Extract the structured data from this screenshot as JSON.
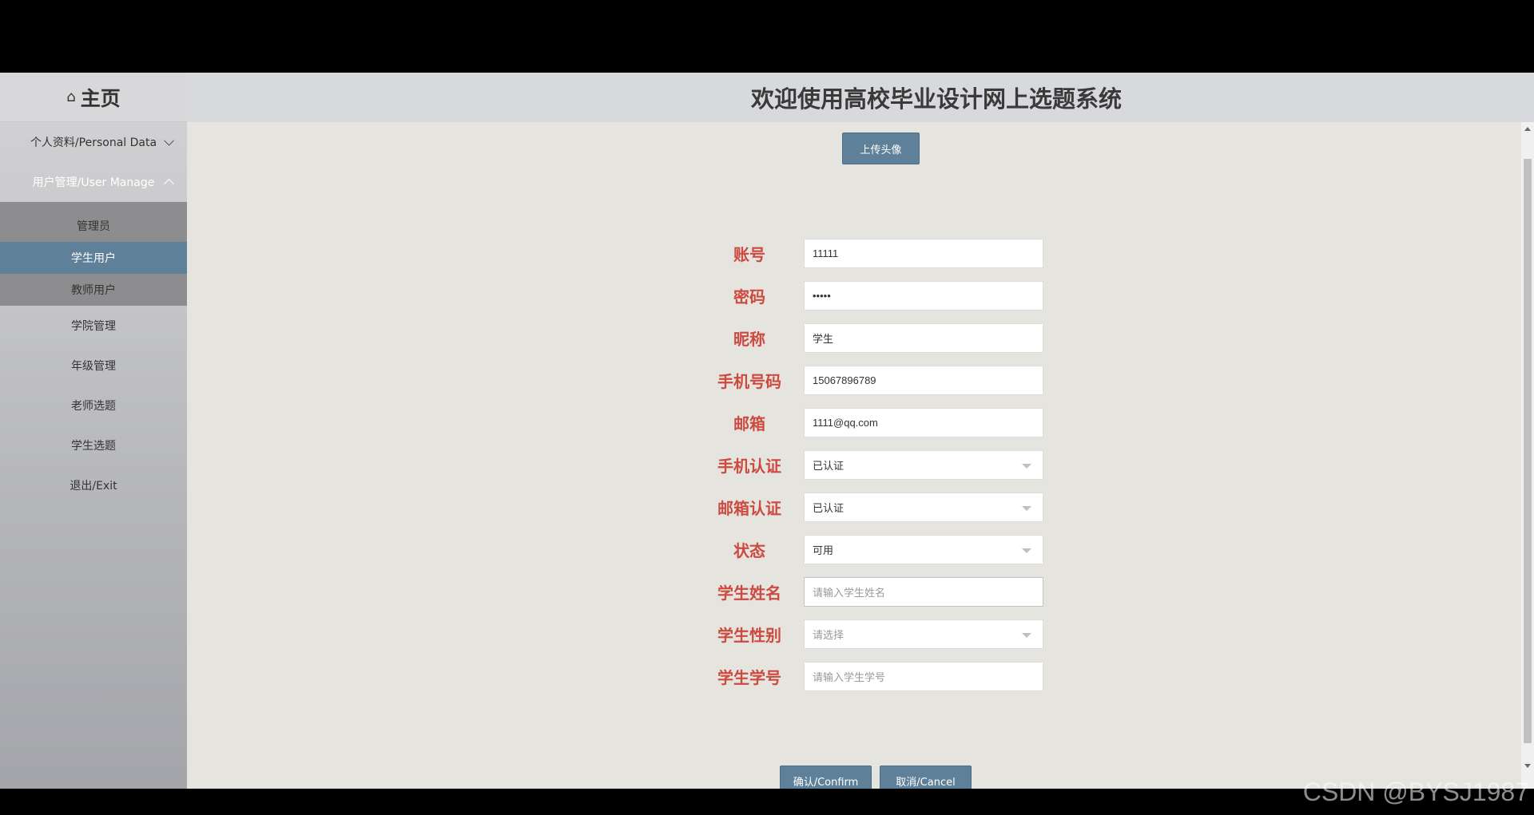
{
  "header": {
    "title": "欢迎使用高校毕业设计网上选题系统"
  },
  "sidebar": {
    "home_label": "主页",
    "home_icon": "home-icon",
    "groups": [
      {
        "label": "个人资料/Personal Data",
        "expanded": false
      },
      {
        "label": "用户管理/User Manage",
        "expanded": true,
        "items": [
          "管理员",
          "学生用户",
          "教师用户"
        ],
        "active_item": "学生用户"
      }
    ],
    "items": [
      "学院管理",
      "年级管理",
      "老师选题",
      "学生选题",
      "退出/Exit"
    ]
  },
  "main": {
    "upload_button": "上传头像",
    "form": {
      "account": {
        "label": "账号",
        "value": "11111"
      },
      "password": {
        "label": "密码",
        "value": "•••••"
      },
      "nickname": {
        "label": "昵称",
        "value": "学生"
      },
      "phone": {
        "label": "手机号码",
        "value": "15067896789"
      },
      "email": {
        "label": "邮箱",
        "value": "1111@qq.com"
      },
      "phone_verify": {
        "label": "手机认证",
        "value": "已认证"
      },
      "email_verify": {
        "label": "邮箱认证",
        "value": "已认证"
      },
      "status": {
        "label": "状态",
        "value": "可用"
      },
      "student_name": {
        "label": "学生姓名",
        "placeholder": "请输入学生姓名"
      },
      "student_gender": {
        "label": "学生性别",
        "placeholder": "请选择"
      },
      "student_id": {
        "label": "学生学号",
        "placeholder": "请输入学生学号"
      }
    },
    "confirm_button": "确认/Confirm",
    "cancel_button": "取消/Cancel"
  },
  "watermark": "CSDN @BYSJ1987",
  "colors": {
    "accent": "#5f8099",
    "label_red": "#cc4a3f",
    "bg": "#e6e4df"
  }
}
